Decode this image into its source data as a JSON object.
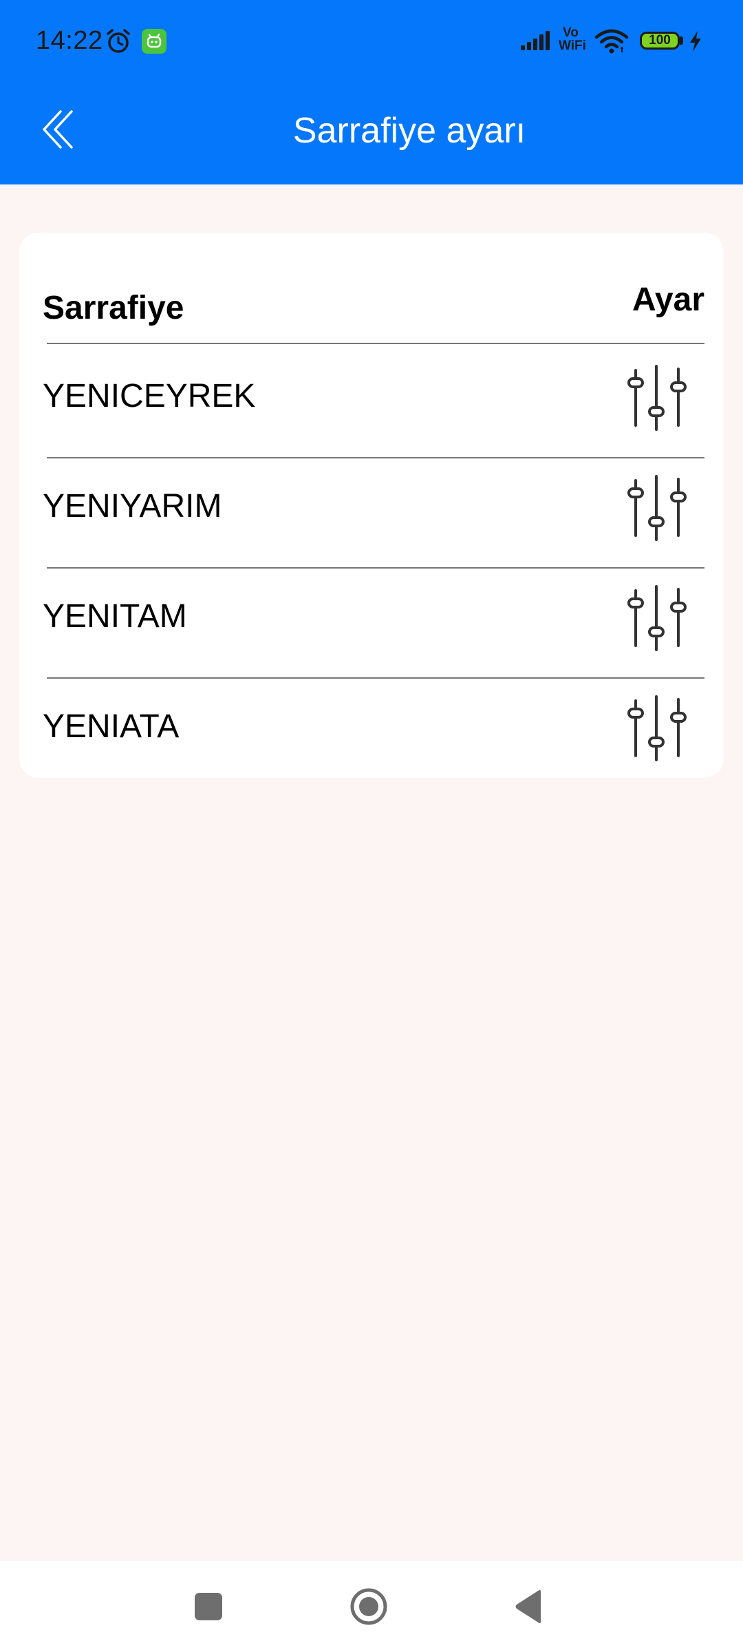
{
  "status_bar": {
    "time": "14:22",
    "vowifi_top": "Vo",
    "vowifi_bottom": "WiFi",
    "battery": "100"
  },
  "header": {
    "title": "Sarrafiye ayarı"
  },
  "table": {
    "col_name": "Sarrafiye",
    "col_action": "Ayar",
    "rows": [
      {
        "label": "YENICEYREK"
      },
      {
        "label": "YENIYARIM"
      },
      {
        "label": "YENITAM"
      },
      {
        "label": "YENIATA"
      }
    ]
  },
  "colors": {
    "app_bar": "#0577fb",
    "background": "#fdf4f4",
    "card": "#ffffff"
  },
  "icons": {
    "back": "double-chevron-left-icon",
    "row_action": "sliders-icon"
  }
}
